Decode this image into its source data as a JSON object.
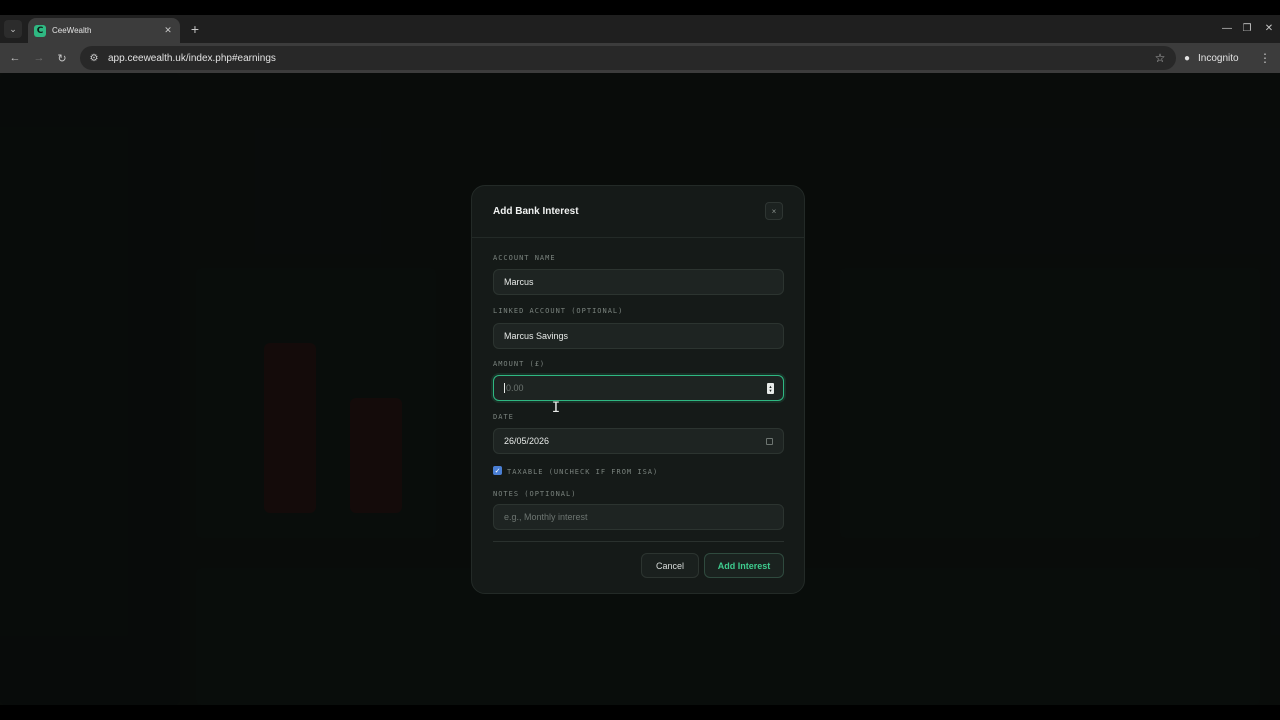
{
  "browser": {
    "tab_title": "CeeWealth",
    "favicon_letter": "C",
    "url": "app.ceewealth.uk/index.php#earnings",
    "profile_label": "Incognito",
    "accent_color": "#2fb882"
  },
  "modal": {
    "title": "Add Bank Interest",
    "close_glyph": "×",
    "fields": {
      "account_name": {
        "label": "ACCOUNT NAME",
        "value": "Marcus"
      },
      "linked_account": {
        "label": "LINKED ACCOUNT (OPTIONAL)",
        "value": "Marcus Savings"
      },
      "amount": {
        "label": "AMOUNT (£)",
        "value": "",
        "placeholder": "0.00"
      },
      "date": {
        "label": "DATE",
        "value": "26/05/2026"
      },
      "notes": {
        "label": "NOTES (OPTIONAL)",
        "value": "",
        "placeholder": "e.g., Monthly interest"
      }
    },
    "taxable": {
      "label": "TAXABLE (UNCHECK IF FROM ISA)",
      "checked": true
    },
    "buttons": {
      "cancel": "Cancel",
      "submit": "Add Interest"
    }
  }
}
